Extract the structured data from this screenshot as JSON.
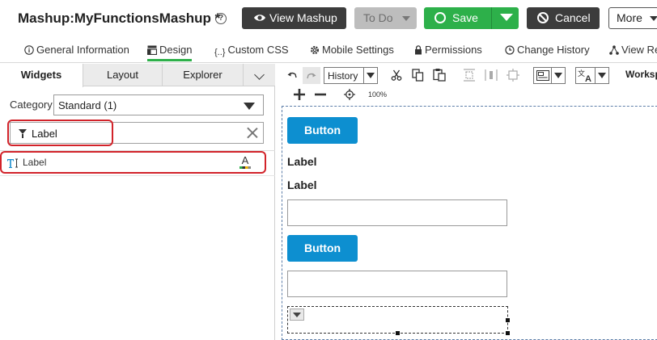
{
  "header": {
    "title_prefix": "Mashup:",
    "title_name": "MyFunctionsMashup *",
    "help_glyph": "?",
    "view_mashup_label": "View Mashup",
    "todo_label": "To Do",
    "save_label": "Save",
    "cancel_label": "Cancel",
    "more_label": "More",
    "colors": {
      "save": "#2db04a",
      "dark": "#3c3c3c",
      "todo": "#bdbdbd"
    }
  },
  "tabs": [
    {
      "label": "General Information",
      "icon": "info-circle-icon"
    },
    {
      "label": "Design",
      "icon": "layout-icon",
      "active": true
    },
    {
      "label": "Custom CSS",
      "icon": "css-braces-icon"
    },
    {
      "label": "Mobile Settings",
      "icon": "gear-icon"
    },
    {
      "label": "Permissions",
      "icon": "lock-icon"
    },
    {
      "label": "Change History",
      "icon": "clock-icon"
    },
    {
      "label": "View Re",
      "icon": "relationship-icon"
    }
  ],
  "left_panel": {
    "tabs": [
      "Widgets",
      "Layout",
      "Explorer"
    ],
    "category_label": "Category",
    "category_value": "Standard (1)",
    "filter_value": "Label",
    "widgets": [
      {
        "label": "Label",
        "icon": "label-widget-icon"
      }
    ],
    "highlight_color": "#d2232a"
  },
  "toolbar": {
    "history_label": "History",
    "zoom_value": "100%",
    "workspace_label": "Worksp"
  },
  "canvas": {
    "button1_label": "Button",
    "label1": "Label",
    "label2": "Label",
    "button2_label": "Button",
    "button_color": "#0d8fd0"
  }
}
